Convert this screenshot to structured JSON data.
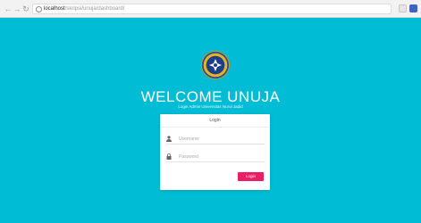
{
  "browser": {
    "back_icon": "arrow-left-icon",
    "forward_icon": "arrow-right-icon",
    "reload_icon": "reload-icon",
    "url_host": "localhost",
    "url_path": "/skripsi/unuja/dashboard/",
    "extension_colors": [
      "#e5e5e5",
      "#3f63c9"
    ]
  },
  "header": {
    "logo_icon": "university-seal-icon",
    "title": "WELCOME UNUJA",
    "subtitle": "Login Admin Universitas Nurul Jadid"
  },
  "login_card": {
    "title": "Login",
    "username_placeholder": "Username",
    "password_placeholder": "Password",
    "username_icon": "user-icon",
    "password_icon": "lock-icon",
    "submit_label": "Login"
  },
  "colors": {
    "background": "#00bcd4",
    "button": "#e91e63"
  }
}
